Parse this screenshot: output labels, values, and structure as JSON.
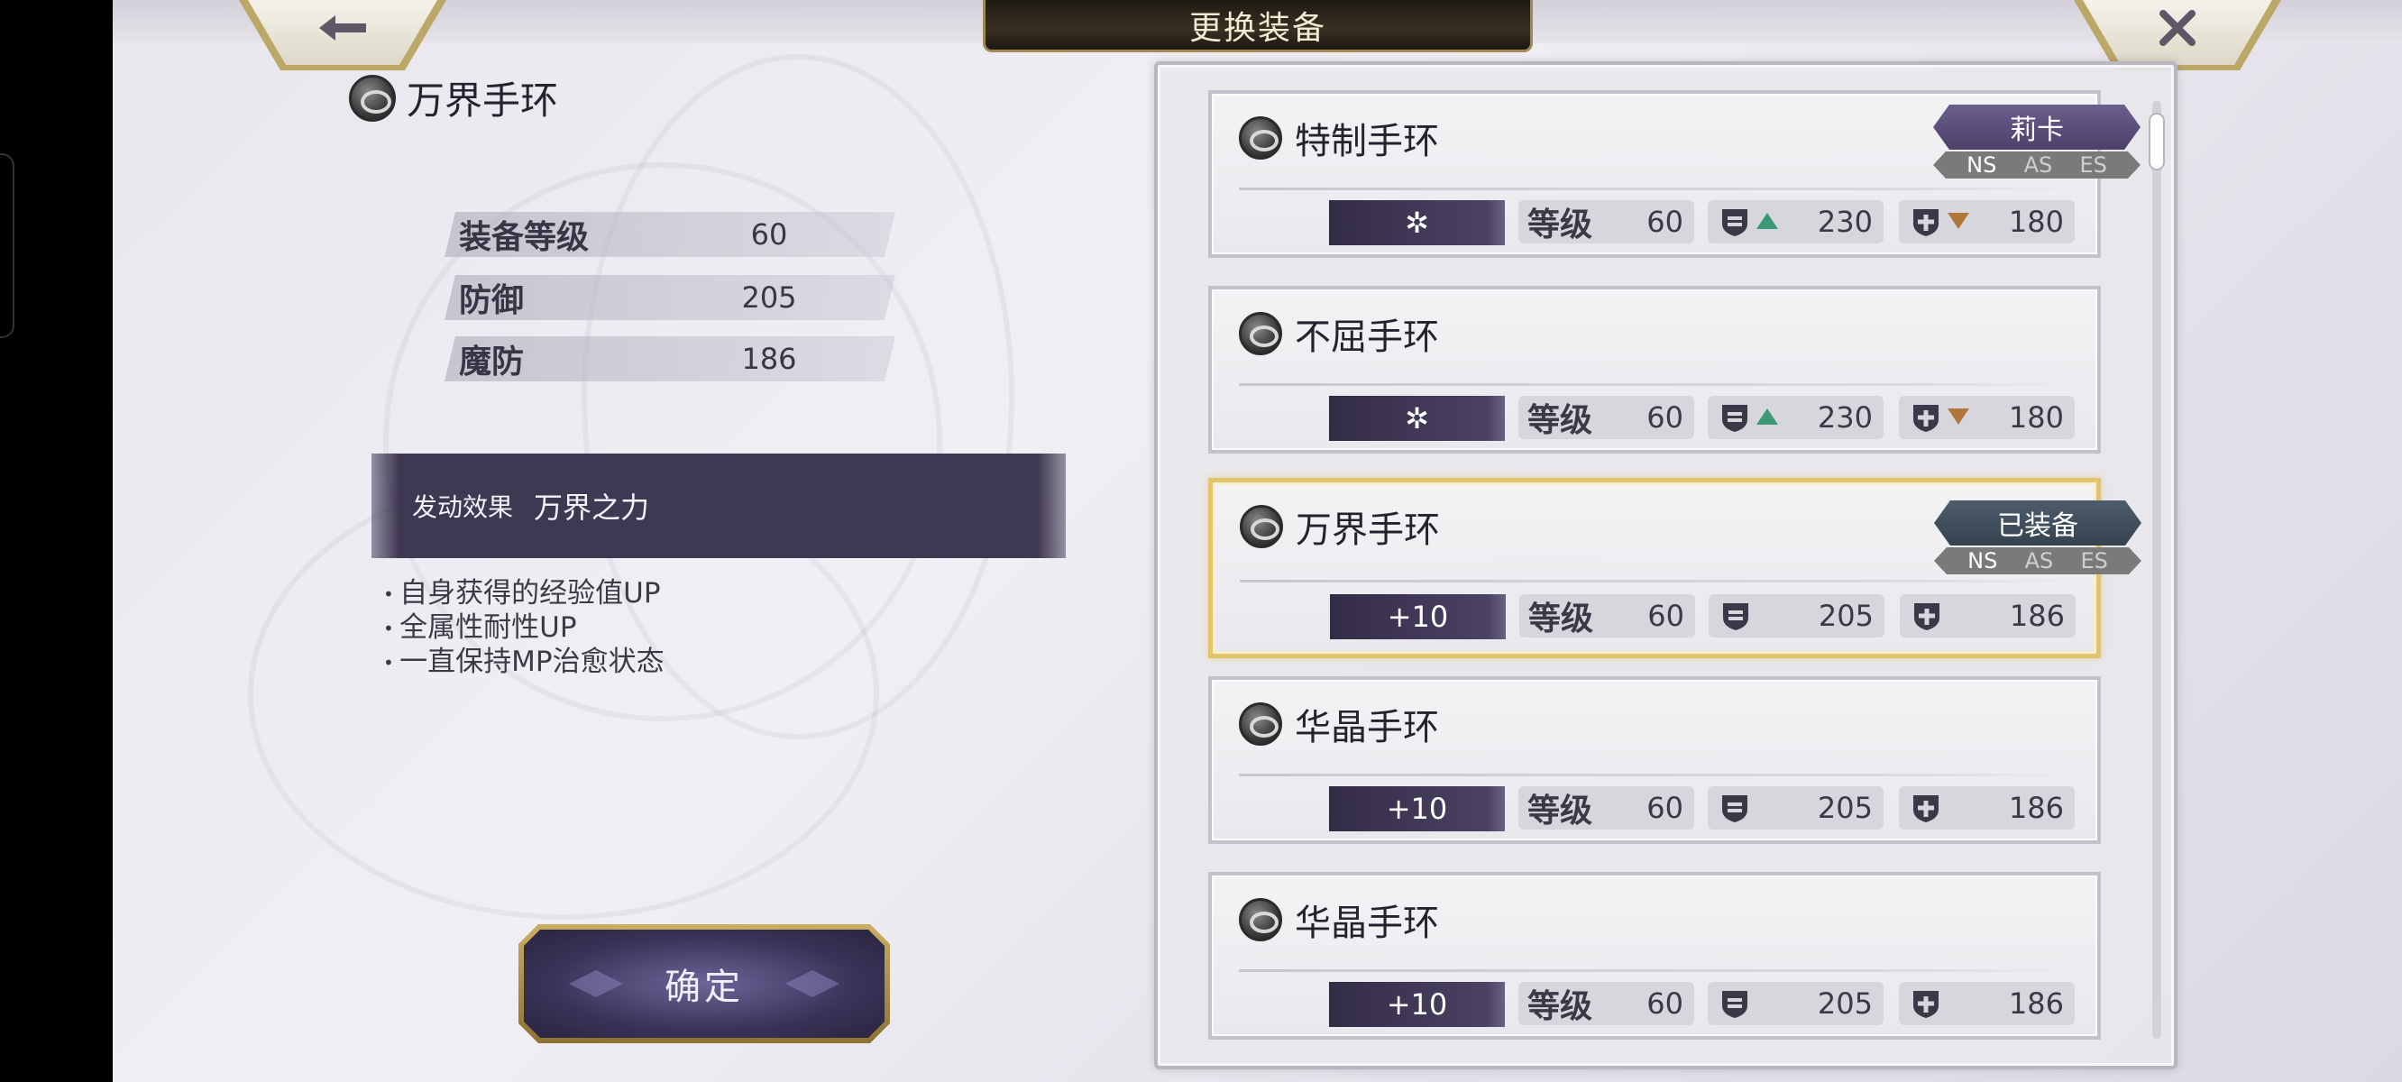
{
  "header": {
    "title": "更换装备",
    "back_icon": "back-arrow-icon",
    "close_icon": "close-x-icon"
  },
  "selected": {
    "name": "万界手环",
    "stats": [
      {
        "label": "装备等级",
        "value": "60"
      },
      {
        "label": "防御",
        "value": "205"
      },
      {
        "label": "魔防",
        "value": "186"
      }
    ],
    "effect_tag": "发动效果",
    "effect_name": "万界之力",
    "effects": [
      "自身获得的经验值UP",
      "全属性耐性UP",
      "一直保持MP治愈状态"
    ],
    "confirm_label": "确定"
  },
  "list": {
    "level_label": "等级",
    "items": [
      {
        "name": "特制手环",
        "rank": "✲",
        "level": "60",
        "def": "230",
        "mdef": "180",
        "def_change": "up",
        "mdef_change": "down",
        "owner": "莉卡",
        "ns": [
          "NS",
          "AS",
          "ES"
        ],
        "equipped": false
      },
      {
        "name": "不屈手环",
        "rank": "✲",
        "level": "60",
        "def": "230",
        "mdef": "180",
        "def_change": "up",
        "mdef_change": "down",
        "owner": "",
        "equipped": false
      },
      {
        "name": "万界手环",
        "rank": "+10",
        "level": "60",
        "def": "205",
        "mdef": "186",
        "def_change": "",
        "mdef_change": "",
        "owner": "已装备",
        "ns": [
          "NS",
          "AS",
          "ES"
        ],
        "equipped": true
      },
      {
        "name": "华晶手环",
        "rank": "+10",
        "level": "60",
        "def": "205",
        "mdef": "186",
        "def_change": "",
        "mdef_change": "",
        "owner": "",
        "equipped": false
      },
      {
        "name": "华晶手环",
        "rank": "+10",
        "level": "60",
        "def": "205",
        "mdef": "186",
        "def_change": "",
        "mdef_change": "",
        "owner": "",
        "equipped": false
      }
    ]
  },
  "colors": {
    "up_arrow": "#3a9a76",
    "down_arrow": "#b0763a",
    "equipped_border": "#e1c46c"
  }
}
